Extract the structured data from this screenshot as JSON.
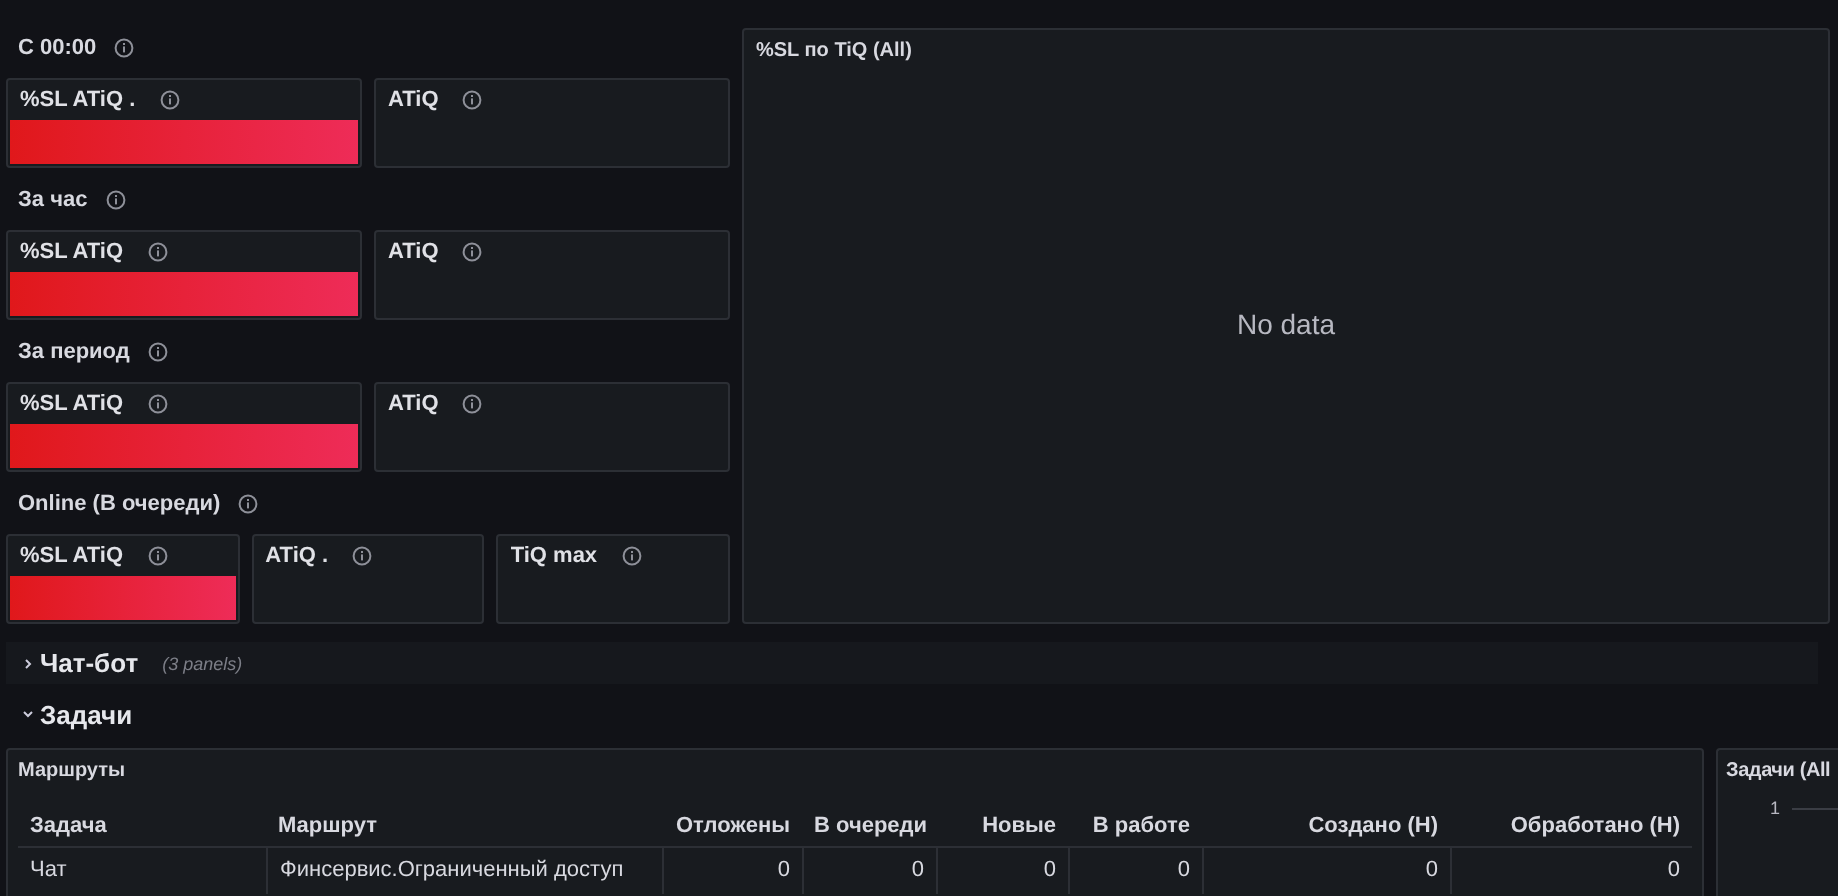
{
  "groups": [
    {
      "title": "С 00:00",
      "stats": [
        {
          "title": "%SL ATiQ .",
          "kind": "colored"
        },
        {
          "title": "ATiQ",
          "kind": "empty"
        }
      ]
    },
    {
      "title": "За час",
      "stats": [
        {
          "title": "%SL ATiQ",
          "kind": "colored"
        },
        {
          "title": "ATiQ",
          "kind": "empty"
        }
      ]
    },
    {
      "title": "За период",
      "stats": [
        {
          "title": "%SL ATiQ",
          "kind": "colored"
        },
        {
          "title": "ATiQ",
          "kind": "empty"
        }
      ]
    },
    {
      "title": "Online (В очереди)",
      "stats": [
        {
          "title": "%SL ATiQ",
          "kind": "colored"
        },
        {
          "title": "ATiQ .",
          "kind": "empty"
        },
        {
          "title": "TiQ max",
          "kind": "empty"
        }
      ]
    }
  ],
  "sl_panel": {
    "title": "%SL по TiQ (All)",
    "message": "No data"
  },
  "rows": [
    {
      "title": "Чат-бот",
      "expanded": false,
      "count": "(3 panels)"
    },
    {
      "title": "Задачи",
      "expanded": true
    }
  ],
  "routes_table": {
    "title": "Маршруты",
    "columns": [
      "Задача",
      "Маршрут",
      "Отложены",
      "В очереди",
      "Новые",
      "В работе",
      "Создано (Н)",
      "Обработано (Н)"
    ],
    "rows": [
      [
        "Чат",
        "Финсервис.Ограниченный доступ",
        "0",
        "0",
        "0",
        "0",
        "0",
        "0"
      ]
    ]
  },
  "tasks_panel": {
    "title": "Задачи (All",
    "y_tick": "1"
  }
}
